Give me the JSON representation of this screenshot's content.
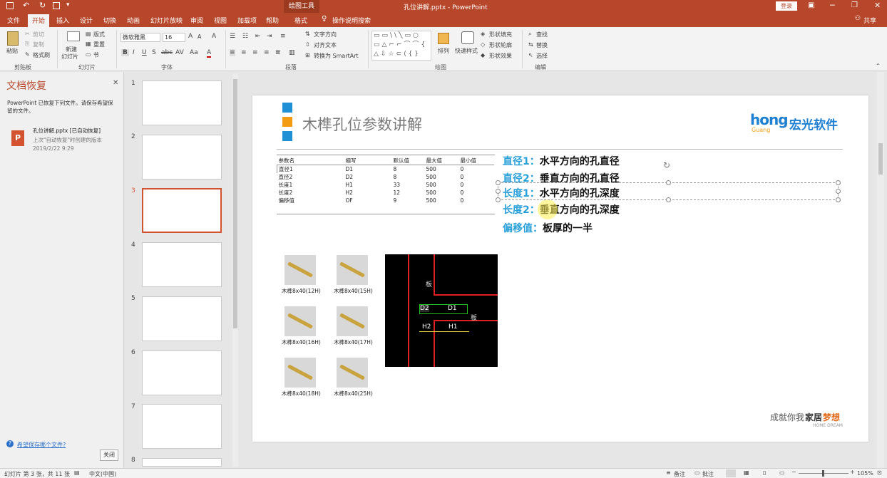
{
  "titlebar": {
    "contextual": "绘图工具",
    "title": "孔位讲解.pptx  -  PowerPoint",
    "login": "登录"
  },
  "tabs": [
    "文件",
    "开始",
    "插入",
    "设计",
    "切换",
    "动画",
    "幻灯片放映",
    "审阅",
    "视图",
    "加载项",
    "帮助",
    "格式"
  ],
  "tab_search": "操作说明搜索",
  "share": "共享",
  "ribbon": {
    "clipboard": {
      "paste": "粘贴",
      "cut": "剪切",
      "copy": "复制",
      "format_painter": "格式刷",
      "group": "剪贴板"
    },
    "slides": {
      "new_slide": "新建",
      "new_slide2": "幻灯片",
      "layout": "版式",
      "reset": "重置",
      "section": "节",
      "group": "幻灯片"
    },
    "font": {
      "name": "微软雅黑",
      "size": "16",
      "group": "字体"
    },
    "paragraph": {
      "text_direction": "文字方向",
      "align_text": "对齐文本",
      "smartart": "转换为 SmartArt",
      "group": "段落"
    },
    "drawing": {
      "arrange": "排列",
      "quick_styles": "快速样式",
      "fill": "形状填充",
      "outline": "形状轮廓",
      "effects": "形状效果",
      "group": "绘图"
    },
    "editing": {
      "find": "查找",
      "replace": "替换",
      "select": "选择",
      "group": "编辑"
    }
  },
  "recovery": {
    "title": "文档恢复",
    "desc": "PowerPoint 已恢复下列文件。请保存希望保留的文件。",
    "file_name": "孔位讲解.pptx  [已自动恢复]",
    "file_sub": "上次\"自动恢复\"时创建的版本",
    "file_date": "2019/2/22 9:29",
    "help_link": "希望保存哪个文件?",
    "close": "关闭"
  },
  "thumbnails": [
    "1",
    "2",
    "3",
    "4",
    "5",
    "6",
    "7",
    "8"
  ],
  "slide": {
    "title": "木榫孔位参数讲解",
    "logo_en": "hong",
    "logo_sub": "Guang",
    "logo_cn": "宏光软件",
    "table": {
      "headers": [
        "参数名",
        "缩写",
        "默认值",
        "最大值",
        "最小值"
      ],
      "rows": [
        [
          "直径1",
          "D1",
          "8",
          "500",
          "0"
        ],
        [
          "直径2",
          "D2",
          "8",
          "500",
          "0"
        ],
        [
          "长度1",
          "H1",
          "33",
          "500",
          "0"
        ],
        [
          "长度2",
          "H2",
          "12",
          "500",
          "0"
        ],
        [
          "偏移值",
          "OF",
          "9",
          "500",
          "0"
        ]
      ]
    },
    "labels": [
      {
        "key": "直径1：",
        "val": "水平方向的孔直径"
      },
      {
        "key": "直径2：",
        "val": "垂直方向的孔直径"
      },
      {
        "key": "长度1：",
        "val": "水平方向的孔深度"
      },
      {
        "key": "长度2：",
        "val": "垂直方向的孔深度"
      },
      {
        "key": "偏移值：",
        "val": "板厚的一半"
      }
    ],
    "pictures": [
      "木榫8x40(12H)",
      "木榫8x40(15H)",
      "木榫8x40(16H)",
      "木榫8x40(17H)",
      "木榫8x40(18H)",
      "木榫8x40(25H)"
    ],
    "diagram": {
      "board1": "板",
      "board2": "板",
      "d2": "D2",
      "d1": "D1",
      "h2": "H2",
      "h1": "H1"
    },
    "slogan_a": "成就你我",
    "slogan_b": "家居",
    "slogan_c": "梦想",
    "slogan_en": "HOME DREAM"
  },
  "status": {
    "slide": "幻灯片 第 3 张，共 11 张",
    "lang": "中文(中国)",
    "notes": "备注",
    "comments": "批注",
    "zoom": "105%"
  },
  "colors": {
    "accent": "#b7472a",
    "blue_label": "#2aa0d8",
    "thumb_sel": "#d35230"
  }
}
